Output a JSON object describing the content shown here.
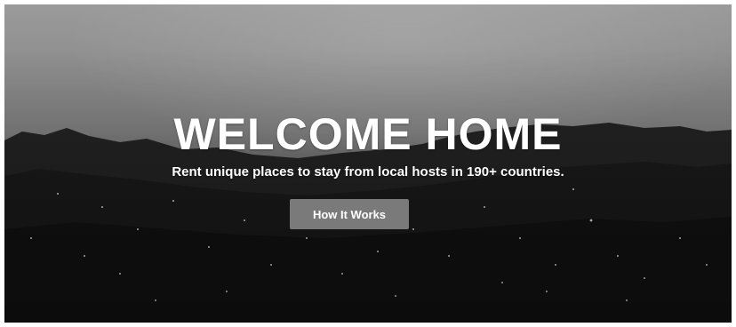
{
  "hero": {
    "title": "WELCOME HOME",
    "subtitle": "Rent unique places to stay from local hosts in 190+ countries.",
    "cta_label": "How It Works"
  },
  "colors": {
    "text": "#ffffff",
    "button_bg": "#b9b9b9",
    "background": "#111111"
  }
}
